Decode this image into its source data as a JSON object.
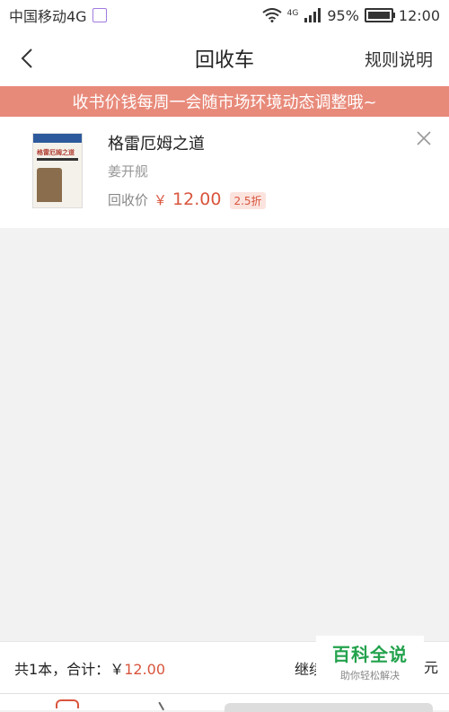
{
  "status_bar": {
    "carrier": "中国移动4G",
    "network": "4G",
    "battery": "95%",
    "time": "12:00"
  },
  "header": {
    "title": "回收车",
    "rules_label": "规则说明"
  },
  "banner": {
    "text": "收书价钱每周一会随市场环境动态调整哦~"
  },
  "item": {
    "title": "格雷厄姆之道",
    "author": "姜开舰",
    "cover_title": "格雷厄姆之道",
    "price_label": "回收价",
    "currency": "￥",
    "price": "12.00",
    "discount": "2.5折"
  },
  "bottom_bar": {
    "summary_prefix": "共1本，合计：",
    "summary_currency": "￥",
    "summary_amount": "12.00",
    "continue_label": "继续扫",
    "edge_char": "元"
  },
  "watermark": {
    "title": "百科全说",
    "subtitle": "助你轻松解决"
  },
  "colors": {
    "accent": "#d9553d",
    "banner": "#e88a7a",
    "watermark": "#23a24d"
  }
}
